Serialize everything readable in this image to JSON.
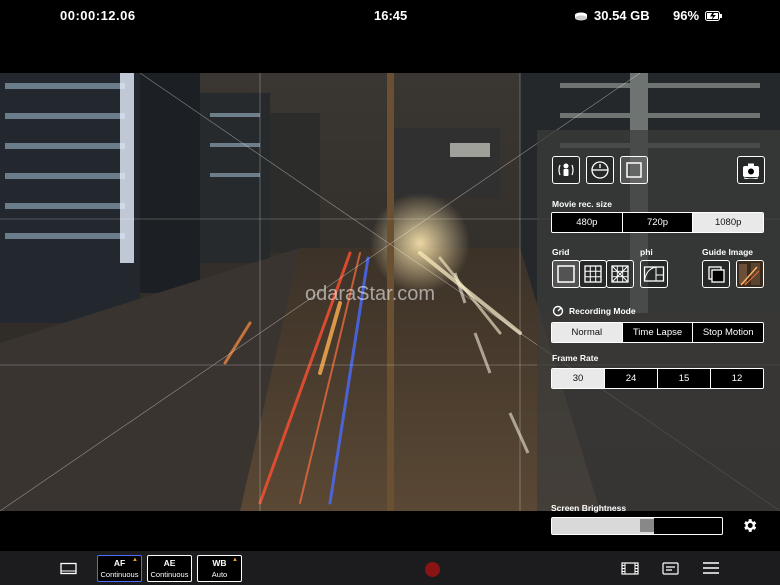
{
  "status": {
    "timecode": "00:00:12.06",
    "clock": "16:45",
    "storage": "30.54 GB",
    "battery": "96%"
  },
  "watermark": "odaraStar.com",
  "panel": {
    "movie_size_label": "Movie rec. size",
    "movie_sizes": [
      "480p",
      "720p",
      "1080p"
    ],
    "movie_size_selected": "1080p",
    "grid_label": "Grid",
    "phi_label": "phi",
    "guide_label": "Guide Image",
    "recording_mode_label": "Recording Mode",
    "recording_modes": [
      "Normal",
      "Time Lapse",
      "Stop Motion"
    ],
    "recording_mode_selected": "Normal",
    "frame_rate_label": "Frame Rate",
    "frame_rates": [
      "30",
      "24",
      "15",
      "12"
    ],
    "frame_rate_selected": "30"
  },
  "brightness": {
    "label": "Screen Brightness",
    "level": 0.6
  },
  "toolbar": {
    "af": {
      "key": "AF",
      "value": "Continuous"
    },
    "ae": {
      "key": "AE",
      "value": "Continuous"
    },
    "wb": {
      "key": "WB",
      "value": "Auto"
    }
  },
  "icons": {
    "storage": "disk-icon",
    "battery": "battery-charging-icon",
    "settings": "gear-icon",
    "record": "record-button"
  }
}
